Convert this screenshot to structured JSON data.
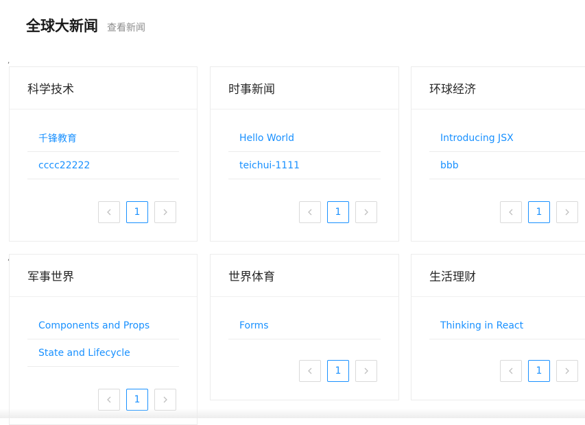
{
  "header": {
    "title": "全球大新闻",
    "subtitle": "查看新闻"
  },
  "cards": [
    {
      "title": "科学技术",
      "items": [
        "千锋教育",
        "cccc22222"
      ],
      "page": "1"
    },
    {
      "title": "时事新闻",
      "items": [
        "Hello World",
        "teichui-1111"
      ],
      "page": "1"
    },
    {
      "title": "环球经济",
      "items": [
        "Introducing JSX",
        "bbb"
      ],
      "page": "1"
    },
    {
      "title": "军事世界",
      "items": [
        "Components and Props",
        "State and Lifecycle"
      ],
      "page": "1"
    },
    {
      "title": "世界体育",
      "items": [
        "Forms"
      ],
      "page": "1"
    },
    {
      "title": "生活理财",
      "items": [
        "Thinking in React"
      ],
      "page": "1"
    }
  ],
  "colors": {
    "link": "#1890ff",
    "border": "#ececec"
  },
  "icons": {
    "prev": "chevron-left-icon",
    "next": "chevron-right-icon"
  }
}
